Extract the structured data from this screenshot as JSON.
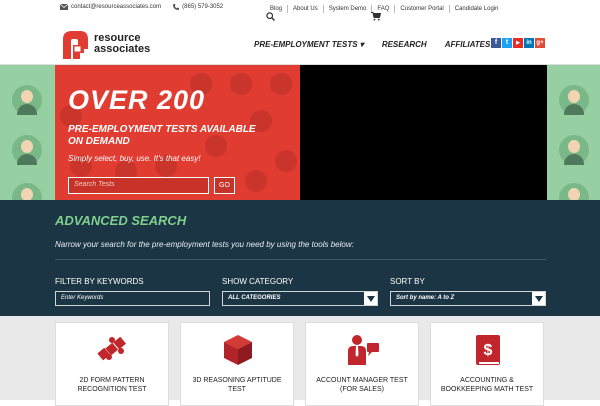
{
  "topbar": {
    "email": "contact@resourceassociates.com",
    "phone": "(865) 579-3052",
    "links": [
      "Blog",
      "About Us",
      "System Demo",
      "FAQ",
      "Customer Portal",
      "Candidate Login"
    ]
  },
  "header": {
    "logo_line1": "resource",
    "logo_line2": "associates",
    "nav": [
      "PRE-EMPLOYMENT TESTS ▾",
      "RESEARCH",
      "AFFILIATES"
    ],
    "social": [
      {
        "icon": "facebook-icon",
        "glyph": "f",
        "color": "#3b5998"
      },
      {
        "icon": "twitter-icon",
        "glyph": "t",
        "color": "#1da1f2"
      },
      {
        "icon": "youtube-icon",
        "glyph": "▶",
        "color": "#e52d27"
      },
      {
        "icon": "linkedin-icon",
        "glyph": "in",
        "color": "#0077b5"
      },
      {
        "icon": "googleplus-icon",
        "glyph": "g+",
        "color": "#dd4b39"
      }
    ]
  },
  "hero": {
    "headline": "OVER 200",
    "subhead": "PRE-EMPLOYMENT TESTS AVAILABLE ON DEMAND",
    "tagline": "Simply select, buy, use. It's that easy!",
    "search_placeholder": "Search Tests",
    "go_label": "GO"
  },
  "advanced": {
    "title": "ADVANCED SEARCH",
    "description": "Narrow your search for the pre-employment tests you need by using the tools below:",
    "filter_label": "FILTER BY KEYWORDS",
    "filter_placeholder": "Enter Keywords",
    "category_label": "SHOW CATEGORY",
    "category_value": "ALL CATEGORIES",
    "sort_label": "SORT BY",
    "sort_value": "Sort by name: A to Z"
  },
  "cards": [
    {
      "line1": "2D FORM PATTERN",
      "line2": "RECOGNITION TEST",
      "icon": "puzzle-icon"
    },
    {
      "line1": "3D REASONING APTITUDE",
      "line2": "TEST",
      "icon": "cube-icon"
    },
    {
      "line1": "ACCOUNT MANAGER TEST",
      "line2": "(FOR SALES)",
      "icon": "salesperson-icon"
    },
    {
      "line1": "ACCOUNTING &",
      "line2": "BOOKKEEPING MATH TEST",
      "icon": "dollar-book-icon"
    }
  ],
  "colors": {
    "brand_red": "#e03c31",
    "navy": "#1c3544",
    "accent_green": "#7fd08e",
    "icon_red": "#c0262b"
  }
}
